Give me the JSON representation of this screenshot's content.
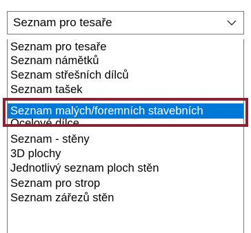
{
  "combo": {
    "selected_value": "Seznam pro tesaře",
    "arrow_icon": "chevron-down-icon"
  },
  "list": {
    "items": [
      "Seznam pro tesaře",
      "Seznam námětků",
      "Seznam střešních dílců",
      "Seznam tašek",
      "Seznam malých/foremních stavebních",
      "Ocelové dílce",
      "Seznam - stěny",
      "3D plochy",
      "Jednotlivý seznam ploch stěn",
      "Seznam pro strop",
      "Seznam zářezů stěn"
    ],
    "selected_index": 4
  },
  "colors": {
    "selection": "#0078d7",
    "highlight_frame": "#8b2233",
    "border": "#7a7a7a"
  }
}
